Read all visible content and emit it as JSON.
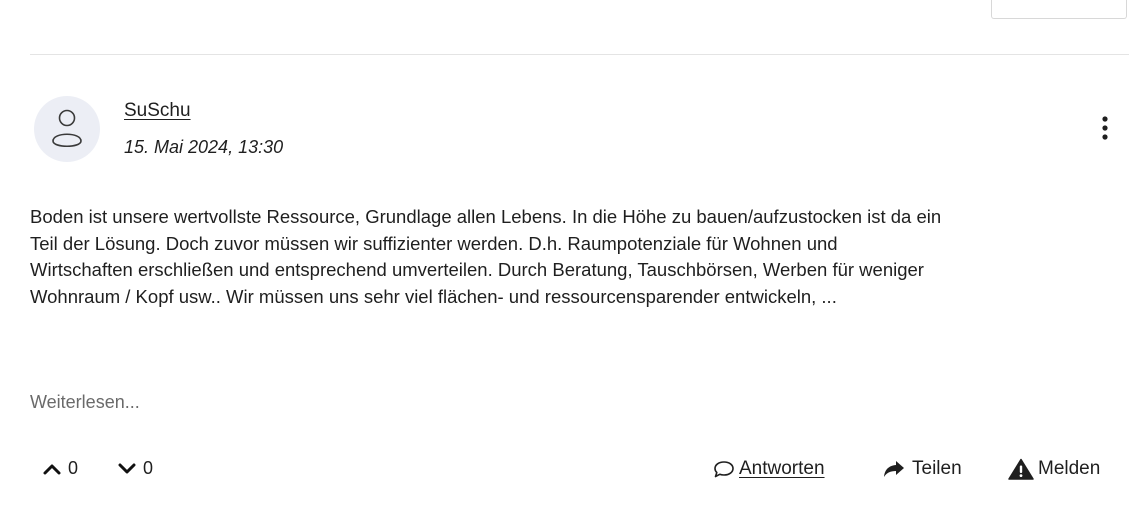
{
  "comment": {
    "author": "SuSchu",
    "date": "15. Mai 2024, 13:30",
    "body_lines": [
      "Boden ist unsere wertvollste Ressource, Grundlage allen Lebens. In die Höhe zu bauen/aufzustocken ist da ein",
      "Teil der Lösung. Doch zuvor müssen wir suffizienter werden. D.h. Raumpotenziale für Wohnen und",
      "Wirtschaften erschließen und entsprechend umverteilen. Durch Beratung, Tauschbörsen, Werben für weniger",
      "Wohnraum / Kopf usw.. Wir müssen uns sehr viel flächen- und ressourcensparender entwickeln, ..."
    ],
    "read_more": "Weiterlesen..."
  },
  "votes": {
    "up_count": "0",
    "down_count": "0"
  },
  "actions": {
    "reply": "Antworten",
    "share": "Teilen",
    "report": "Melden"
  },
  "icons": {
    "avatar": "user-icon",
    "more": "kebab-menu-icon",
    "upvote": "chevron-up-icon",
    "downvote": "chevron-down-icon",
    "reply": "speech-bubble-icon",
    "share": "share-arrow-icon",
    "report": "warning-triangle-icon"
  },
  "colors": {
    "avatar_bg": "#eceef5",
    "text": "#1f1f1f",
    "muted": "#6a6a6a",
    "divider": "#e4e4e4"
  }
}
